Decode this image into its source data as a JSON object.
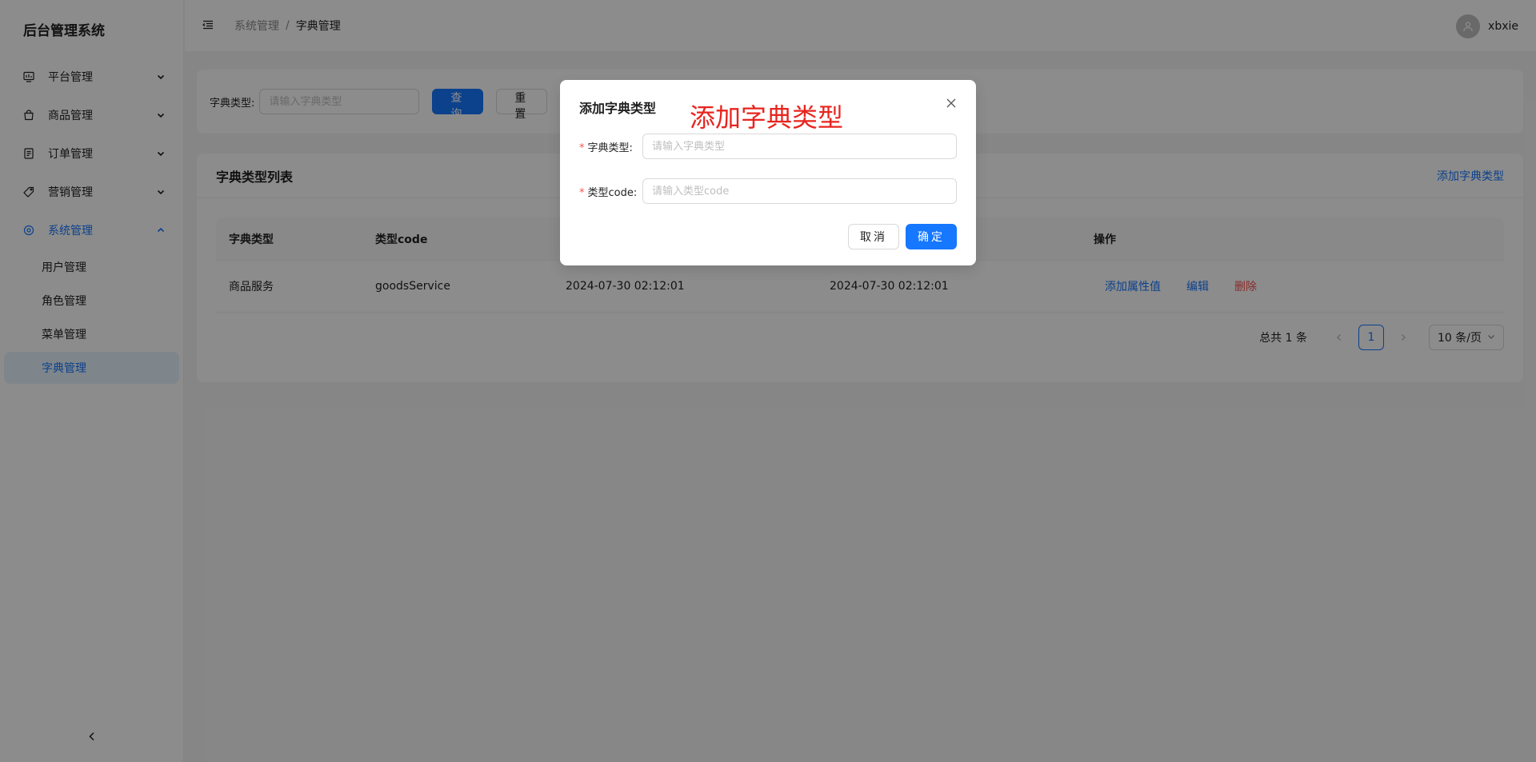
{
  "sidebar": {
    "logo": "后台管理系统",
    "menus": [
      {
        "label": "平台管理",
        "icon": "dashboard-icon",
        "open": false
      },
      {
        "label": "商品管理",
        "icon": "shopping-bag-icon",
        "open": false
      },
      {
        "label": "订单管理",
        "icon": "order-icon",
        "open": false
      },
      {
        "label": "营销管理",
        "icon": "tag-icon",
        "open": false
      },
      {
        "label": "系统管理",
        "icon": "settings-icon",
        "open": true
      }
    ],
    "submenu": [
      {
        "label": "用户管理",
        "active": false
      },
      {
        "label": "角色管理",
        "active": false
      },
      {
        "label": "菜单管理",
        "active": false
      },
      {
        "label": "字典管理",
        "active": true
      }
    ]
  },
  "header": {
    "breadcrumb": {
      "parent": "系统管理",
      "separator": "/",
      "current": "字典管理"
    },
    "username": "xbxie"
  },
  "search": {
    "label": "字典类型:",
    "placeholder": "请输入字典类型",
    "query_label": "查询",
    "reset_label": "重置"
  },
  "list": {
    "title": "字典类型列表",
    "add_label": "添加字典类型",
    "columns": [
      "字典类型",
      "类型code",
      "",
      "",
      "操作"
    ],
    "rows": [
      {
        "type": "商品服务",
        "code": "goodsService",
        "created": "2024-07-30 02:12:01",
        "updated": "2024-07-30 02:12:01",
        "ops": [
          "添加属性值",
          "编辑",
          "删除"
        ]
      }
    ],
    "pagination": {
      "total": "总共 1 条",
      "page": "1",
      "size": "10 条/页"
    }
  },
  "modal": {
    "title": "添加字典类型",
    "annotation": "添加字典类型",
    "fields": [
      {
        "label": "字典类型:",
        "placeholder": "请输入字典类型",
        "required": "*"
      },
      {
        "label": "类型code:",
        "placeholder": "请输入类型code",
        "required": "*"
      }
    ],
    "cancel_label": "取消",
    "ok_label": "确定"
  },
  "colors": {
    "primary": "#1677ff",
    "danger": "#ff4d4f",
    "annotation": "#e8241e",
    "overlay": "rgba(0,0,0,0.45)"
  }
}
